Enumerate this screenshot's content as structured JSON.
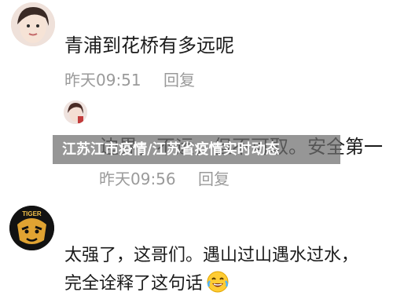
{
  "comments": [
    {
      "text": "青浦到花桥有多远呢",
      "time": "昨天09:51",
      "reply_label": "回复"
    },
    {
      "text_hidden_part": "边界，不远，但不可取。安全第一",
      "time": "昨天09:56",
      "reply_label": "回复"
    },
    {
      "text_line1": "太强了，这哥们。遇山过山遇水过水，",
      "text_line2": "完全诠释了这句话",
      "emoji": "laughing-crying-emoji",
      "avatar_badge": "TIGER"
    }
  ],
  "overlay_banner": "江苏江市疫情/江苏省疫情实时动态",
  "colors": {
    "banner_bg": "#6e6e6e",
    "meta_text": "#9a9a9a",
    "body_text": "#1b1b1b"
  }
}
